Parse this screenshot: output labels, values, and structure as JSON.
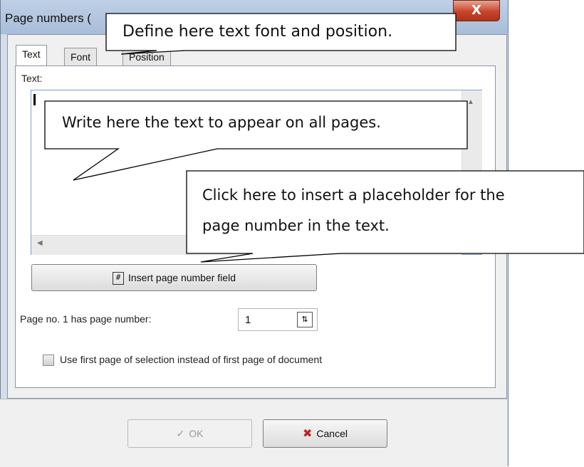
{
  "window": {
    "title": "Page numbers ("
  },
  "tabs": [
    "Text",
    "Font",
    "Position"
  ],
  "text_tab": {
    "label": "Text:",
    "value": ""
  },
  "insert_button": {
    "label": "Insert page number field",
    "icon": "#"
  },
  "page_no": {
    "label": "Page no. 1 has page number:",
    "value": "1"
  },
  "checkbox": {
    "label": "Use first page of selection instead of first page of document",
    "checked": false
  },
  "buttons": {
    "ok": "OK",
    "cancel": "Cancel"
  },
  "callouts": {
    "font_position": "Define here text font and position.",
    "write_text": "Write here the text to appear on all pages.",
    "placeholder_line1": "Click here to insert a placeholder for the",
    "placeholder_line2": "page number in the text."
  }
}
